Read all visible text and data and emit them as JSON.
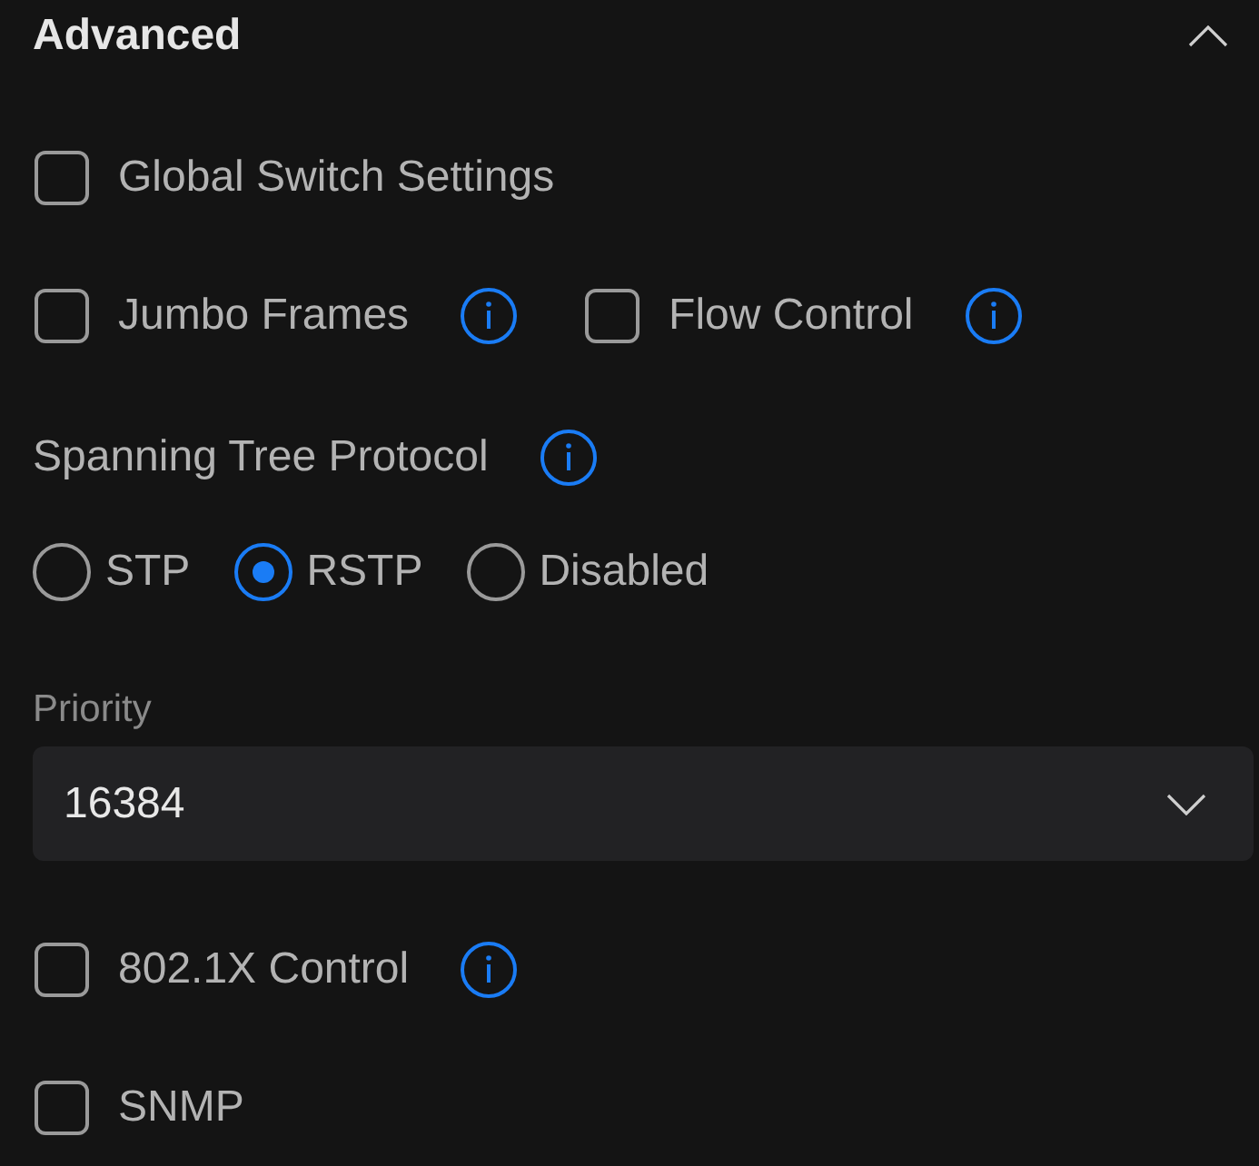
{
  "section": {
    "title": "Advanced",
    "expanded": true
  },
  "rows": [
    {
      "kind": "checkboxes",
      "items": [
        {
          "label": "Global Switch Settings",
          "checked": false,
          "info": false
        }
      ]
    },
    {
      "kind": "checkboxes",
      "items": [
        {
          "label": "Jumbo Frames",
          "checked": false,
          "info": true
        },
        {
          "label": "Flow Control",
          "checked": false,
          "info": true
        }
      ]
    },
    {
      "kind": "heading",
      "label": "Spanning Tree Protocol",
      "info": true
    },
    {
      "kind": "radios",
      "options": [
        {
          "label": "STP",
          "selected": false
        },
        {
          "label": "RSTP",
          "selected": true
        },
        {
          "label": "Disabled",
          "selected": false
        }
      ]
    },
    {
      "kind": "select",
      "label": "Priority",
      "value": "16384"
    },
    {
      "kind": "checkboxes",
      "items": [
        {
          "label": "802.1X Control",
          "checked": false,
          "info": true
        }
      ]
    },
    {
      "kind": "checkboxes",
      "items": [
        {
          "label": "SNMP",
          "checked": false,
          "info": false
        }
      ]
    }
  ]
}
